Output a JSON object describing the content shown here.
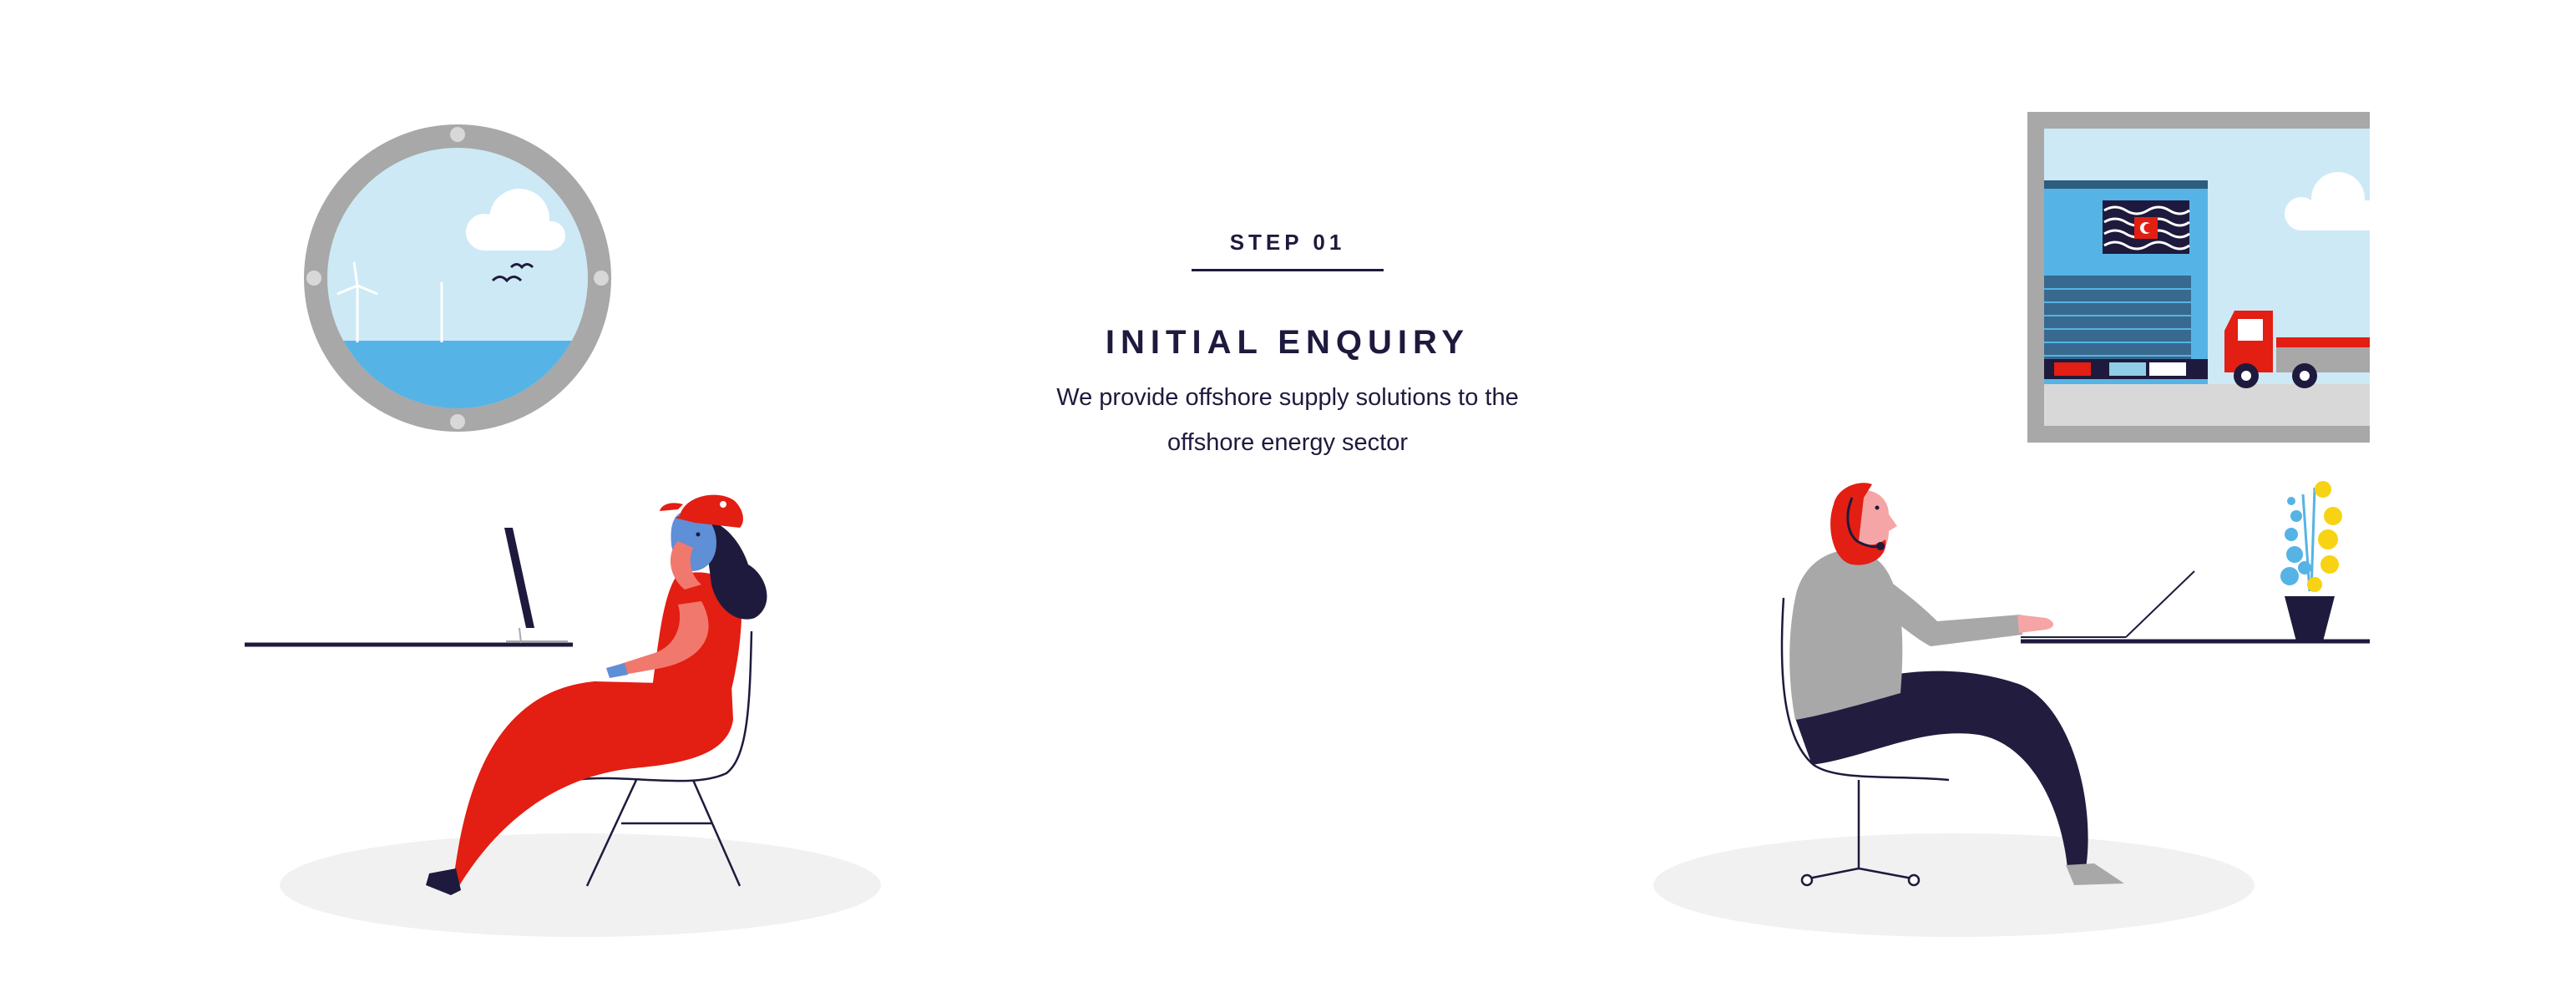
{
  "step": {
    "label": "STEP 01"
  },
  "heading": {
    "title": "INITIAL ENQUIRY",
    "description": "We provide offshore supply solutions to the offshore energy sector"
  },
  "colors": {
    "navy": "#1e1a3d",
    "red": "#e31e13",
    "sky": "#cde9f6",
    "sea": "#56b3e6",
    "grey": "#a8a8a8",
    "floor_shadow": "#f1f1f1",
    "yellow": "#f7d313"
  },
  "icons": {
    "porthole": "porthole-window-icon",
    "truck": "truck-icon",
    "flag": "wavy-flag-icon",
    "plant": "potted-plant-icon"
  }
}
